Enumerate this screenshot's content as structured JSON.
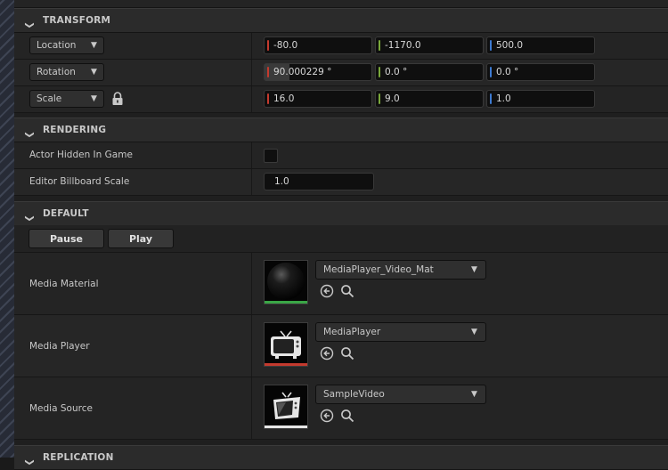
{
  "sections": {
    "transform": "TRANSFORM",
    "rendering": "RENDERING",
    "default": "DEFAULT",
    "replication": "REPLICATION"
  },
  "transform": {
    "location": {
      "label": "Location",
      "x": "-80.0",
      "y": "-1170.0",
      "z": "500.0"
    },
    "rotation": {
      "label": "Rotation",
      "x": "90.000229 °",
      "y": "0.0 °",
      "z": "0.0 °"
    },
    "scale": {
      "label": "Scale",
      "x": "16.0",
      "y": "9.0",
      "z": "1.0"
    }
  },
  "rendering": {
    "actor_hidden_label": "Actor Hidden In Game",
    "actor_hidden_checked": false,
    "billboard_label": "Editor Billboard Scale",
    "billboard_value": "1.0"
  },
  "default": {
    "pause_label": "Pause",
    "play_label": "Play",
    "media_material": {
      "label": "Media Material",
      "asset": "MediaPlayer_Video_Mat"
    },
    "media_player": {
      "label": "Media Player",
      "asset": "MediaPlayer"
    },
    "media_source": {
      "label": "Media Source",
      "asset": "SampleVideo"
    }
  },
  "colors": {
    "axis_x": "#c43a2e",
    "axis_y": "#7aa83a",
    "axis_z": "#3d7ad1",
    "material_underline": "#3aa646",
    "player_underline": "#c43a2e",
    "source_underline": "#e6e6e6"
  },
  "icons": {
    "collapse": "chevron-down-icon",
    "lock": "lock-icon",
    "use_selected": "arrow-left-circle-icon",
    "browse": "search-icon"
  }
}
